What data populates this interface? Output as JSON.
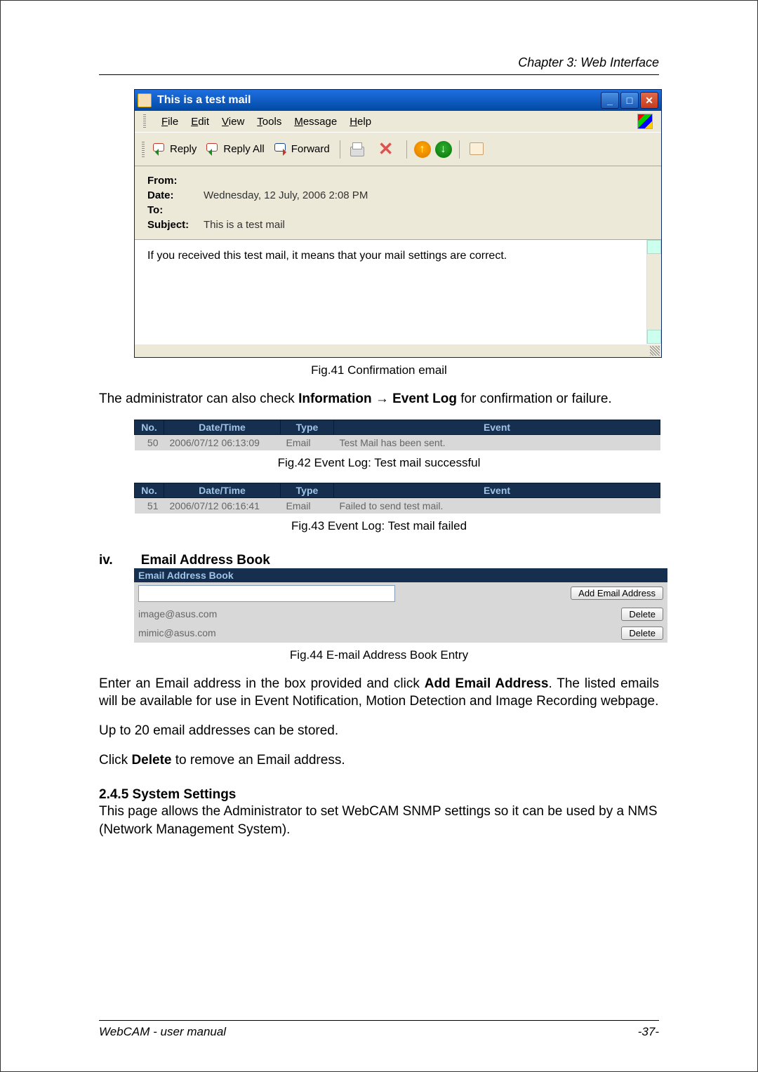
{
  "chapter": "Chapter 3: Web Interface",
  "email_window": {
    "title": "This is a test mail",
    "menu": {
      "file": "File",
      "edit": "Edit",
      "view": "View",
      "tools": "Tools",
      "message": "Message",
      "help": "Help"
    },
    "toolbar": {
      "reply": "Reply",
      "reply_all": "Reply All",
      "forward": "Forward"
    },
    "headers": {
      "from_label": "From:",
      "from_value": "",
      "date_label": "Date:",
      "date_value": "Wednesday, 12 July, 2006 2:08 PM",
      "to_label": "To:",
      "to_value": "",
      "subject_label": "Subject:",
      "subject_value": "This is a test mail"
    },
    "body": "If you received this test mail, it means that your mail settings are correct."
  },
  "caption_41": "Fig.41  Confirmation email",
  "para_admin": "The administrator can also check Information → Event Log for confirmation or failure.",
  "log_headers": {
    "no": "No.",
    "dt": "Date/Time",
    "tp": "Type",
    "ev": "Event"
  },
  "log1": {
    "no": "50",
    "dt": "2006/07/12 06:13:09",
    "tp": "Email",
    "ev": "Test Mail has been sent."
  },
  "caption_42": "Fig.42  Event Log: Test mail successful",
  "log2": {
    "no": "51",
    "dt": "2006/07/12 06:16:41",
    "tp": "Email",
    "ev": "Failed to send test mail."
  },
  "caption_43": "Fig.43  Event Log: Test mail failed",
  "section_iv_num": "iv.",
  "section_iv_title": "Email Address Book",
  "addrbook": {
    "header": "Email Address Book",
    "add_button": "Add Email Address",
    "entries": [
      {
        "email": "image@asus.com",
        "del": "Delete"
      },
      {
        "email": "mimic@asus.com",
        "del": "Delete"
      }
    ]
  },
  "caption_44": "Fig.44  E-mail Address Book Entry",
  "para_enter": "Enter an Email address in the box provided and click Add Email Address. The listed emails will be available for use in Event Notification, Motion Detection and Image Recording webpage.",
  "para_upto": "Up to 20 email addresses can be stored.",
  "para_delete": "Click Delete to remove an Email address.",
  "h_245": "2.4.5 System Settings",
  "para_snmp": "This page allows the Administrator to set WebCAM SNMP settings so it can be used by a NMS (Network Management System).",
  "footer_left": "WebCAM - user manual",
  "footer_right": "-37-"
}
